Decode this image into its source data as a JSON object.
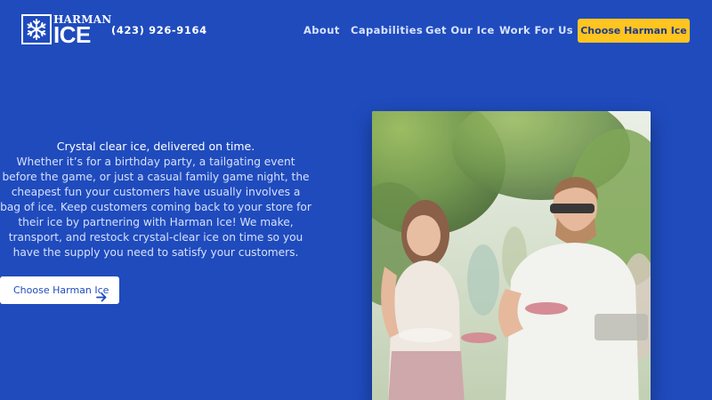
{
  "brand": {
    "logo_top": "HARMAN",
    "logo_bottom": "ICE",
    "logo_icon": "snowflake-icon"
  },
  "header": {
    "phone": "(423) 926-9164",
    "nav": [
      "About",
      "Capabilities",
      "Get Our Ice",
      "Work For Us"
    ],
    "cta": "Choose Harman Ice"
  },
  "hero": {
    "tagline": "Crystal clear ice, delivered on time.",
    "body": "Whether it’s for a birthday party, a tailgating event before the game, or just a casual family game night, the cheapest fun your customers have usually involves a bag of ice. Keep customers coming back to your store for their ice by partnering with Harman Ice! We make, transport, and restock crystal-clear ice on time so you have the supply you need to satisfy your customers.",
    "cta": "Choose Harman Ice",
    "cta_icon": "arrow-right-icon"
  },
  "colors": {
    "background": "#1f4bbd",
    "accent": "#ffc41f",
    "text": "#ffffff"
  }
}
